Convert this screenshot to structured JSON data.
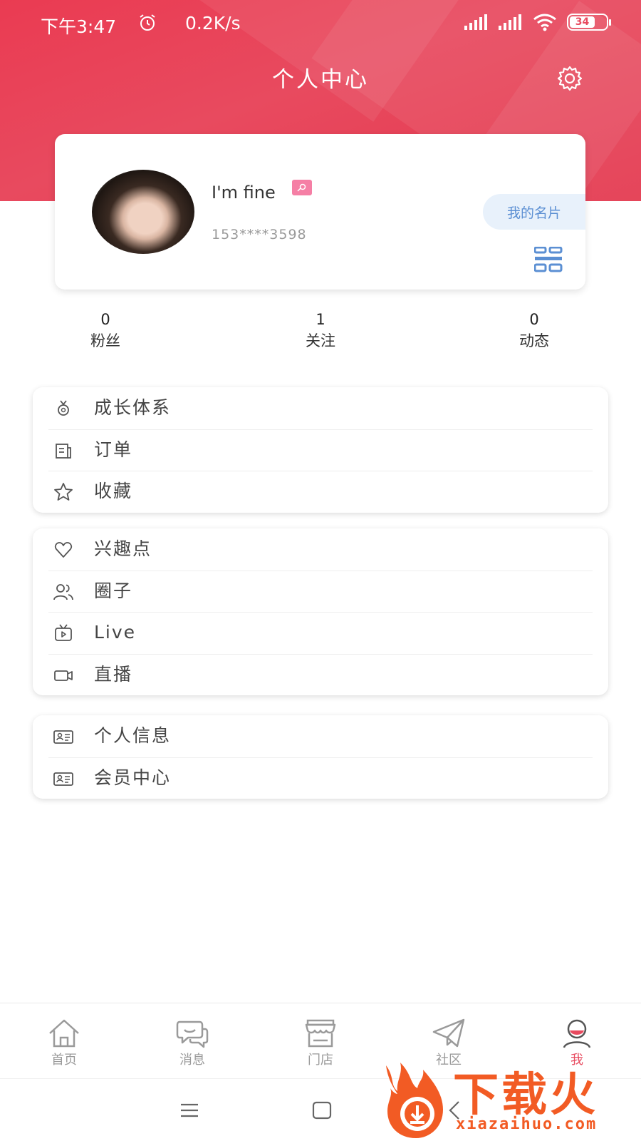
{
  "status_bar": {
    "time": "下午3:47",
    "speed": "0.2K/s",
    "battery": "34"
  },
  "header": {
    "title": "个人中心"
  },
  "profile": {
    "name": "I'm fine",
    "phone": "153****3598",
    "card_button": "我的名片"
  },
  "stats": [
    {
      "value": "0",
      "label": "粉丝"
    },
    {
      "value": "1",
      "label": "关注"
    },
    {
      "value": "0",
      "label": "动态"
    }
  ],
  "menu_groups": [
    [
      {
        "label": "成长体系",
        "icon": "medal-icon"
      },
      {
        "label": "订单",
        "icon": "order-icon"
      },
      {
        "label": "收藏",
        "icon": "star-icon"
      }
    ],
    [
      {
        "label": "兴趣点",
        "icon": "heart-icon"
      },
      {
        "label": "圈子",
        "icon": "people-icon"
      },
      {
        "label": "Live",
        "icon": "tv-icon"
      },
      {
        "label": "直播",
        "icon": "video-camera-icon"
      }
    ],
    [
      {
        "label": "个人信息",
        "icon": "id-card-icon"
      },
      {
        "label": "会员中心",
        "icon": "id-card-icon"
      }
    ]
  ],
  "tabs": [
    {
      "label": "首页",
      "icon": "home-icon"
    },
    {
      "label": "消息",
      "icon": "chat-icon"
    },
    {
      "label": "门店",
      "icon": "store-icon"
    },
    {
      "label": "社区",
      "icon": "paper-plane-icon"
    },
    {
      "label": "我",
      "icon": "profile-icon",
      "active": true
    }
  ],
  "watermark": {
    "text": "下载火",
    "url": "xiazaihuo.com"
  },
  "colors": {
    "brand_red": "#e84a5f",
    "link_blue": "#5b8fd3",
    "watermark_orange": "#f25b24"
  }
}
